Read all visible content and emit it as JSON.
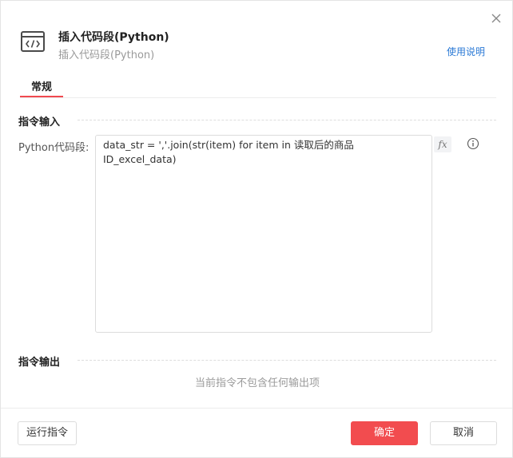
{
  "dialog": {
    "title": "插入代码段(Python)",
    "subtitle": "插入代码段(Python)",
    "help_link": "使用说明",
    "close_icon": "close-icon",
    "command_icon": "code-icon"
  },
  "tabs": [
    {
      "label": "常规",
      "active": true
    }
  ],
  "sections": {
    "input_title": "指令输入",
    "output_title": "指令输出",
    "output_empty": "当前指令不包含任何输出项"
  },
  "fields": {
    "python_code": {
      "label": "Python代码段:",
      "value": "data_str = ','.join(str(item) for item in 读取后的商品ID_excel_data)",
      "fx_label": "fx",
      "info_icon": "info-icon"
    }
  },
  "footer": {
    "run_label": "运行指令",
    "ok_label": "确定",
    "cancel_label": "取消"
  },
  "colors": {
    "accent": "#f24c4f",
    "link": "#2b7ad6"
  }
}
